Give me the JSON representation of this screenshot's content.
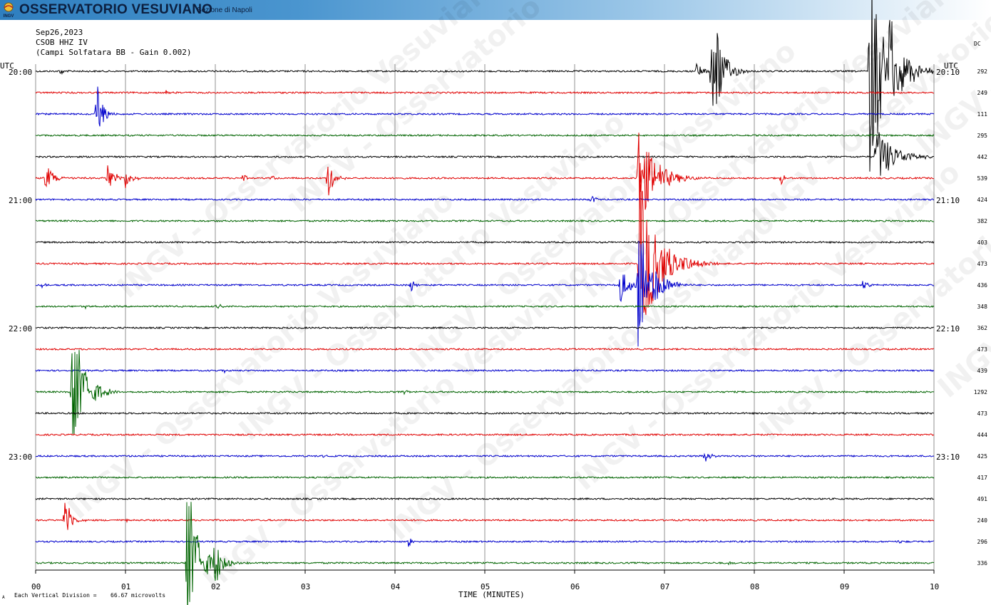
{
  "header": {
    "org_title": "OSSERVATORIO VESUVIANO",
    "org_subtitle": "Sezione di Napoli",
    "logo_text": "INGV",
    "date": "Sep26,2023",
    "station": "CSOB HHZ IV",
    "description": "(Campi Solfatara BB - Gain 0.002)"
  },
  "watermark": "INGV - Osservatorio Vesuviano",
  "footer": {
    "division_label": "Each Vertical Division =",
    "division_value": "66.67 microvolts",
    "corner_mark": "A"
  },
  "colors": {
    "cycle": [
      "#000000",
      "#e00000",
      "#0000cc",
      "#006400"
    ],
    "grid": "#909090",
    "banner": "#2f7fbf"
  },
  "chart_data": {
    "type": "line",
    "title": "",
    "xlabel": "TIME (MINUTES)",
    "ylabel": "",
    "x_ticks": [
      "00",
      "01",
      "02",
      "03",
      "04",
      "05",
      "06",
      "07",
      "08",
      "09",
      "10"
    ],
    "xlim": [
      0,
      10
    ],
    "left_axis_label": "UTC",
    "right_axis_label": "UTC",
    "dc_header": "DC",
    "left_time_labels": [
      {
        "row": 0,
        "label": "20:00"
      },
      {
        "row": 6,
        "label": "21:00"
      },
      {
        "row": 12,
        "label": "22:00"
      },
      {
        "row": 18,
        "label": "23:00"
      }
    ],
    "right_time_labels": [
      {
        "row": 0,
        "label": "20:10"
      },
      {
        "row": 6,
        "label": "21:10"
      },
      {
        "row": 12,
        "label": "22:10"
      },
      {
        "row": 18,
        "label": "23:10"
      }
    ],
    "dc_values": [
      "292",
      "249",
      "111",
      "295",
      "442",
      "539",
      "424",
      "382",
      "403",
      "473",
      "436",
      "348",
      "362",
      "473",
      "439",
      "1292",
      "473",
      "444",
      "425",
      "417",
      "491",
      "240",
      "296",
      "336"
    ],
    "events": [
      {
        "row": 0,
        "t": 0.27,
        "amp": 0.25,
        "dur": 0.15
      },
      {
        "row": 0,
        "t": 7.35,
        "amp": 0.6,
        "dur": 0.25
      },
      {
        "row": 0,
        "t": 7.52,
        "amp": 3.5,
        "dur": 0.45
      },
      {
        "row": 0,
        "t": 9.28,
        "amp": 5.0,
        "dur": 0.8
      },
      {
        "row": 0,
        "t": 9.48,
        "amp": 2.5,
        "dur": 0.6
      },
      {
        "row": 1,
        "t": 1.45,
        "amp": 0.12,
        "dur": 0.2
      },
      {
        "row": 2,
        "t": 0.67,
        "amp": 2.3,
        "dur": 0.25
      },
      {
        "row": 4,
        "t": 9.35,
        "amp": 1.5,
        "dur": 0.8
      },
      {
        "row": 5,
        "t": 0.1,
        "amp": 0.8,
        "dur": 0.35
      },
      {
        "row": 5,
        "t": 0.8,
        "amp": 0.8,
        "dur": 0.3
      },
      {
        "row": 5,
        "t": 1.0,
        "amp": 0.6,
        "dur": 0.25
      },
      {
        "row": 5,
        "t": 2.3,
        "amp": 0.3,
        "dur": 0.15
      },
      {
        "row": 5,
        "t": 2.62,
        "amp": 0.2,
        "dur": 0.12
      },
      {
        "row": 5,
        "t": 3.25,
        "amp": 1.0,
        "dur": 0.3
      },
      {
        "row": 5,
        "t": 8.3,
        "amp": 0.35,
        "dur": 0.15
      },
      {
        "row": 5,
        "t": 6.7,
        "amp": 2.5,
        "dur": 0.8
      },
      {
        "row": 6,
        "t": 6.18,
        "amp": 0.4,
        "dur": 0.15
      },
      {
        "row": 9,
        "t": 6.72,
        "amp": 4.0,
        "dur": 0.9
      },
      {
        "row": 10,
        "t": 0.07,
        "amp": 0.12,
        "dur": 0.15
      },
      {
        "row": 10,
        "t": 4.18,
        "amp": 0.45,
        "dur": 0.15
      },
      {
        "row": 10,
        "t": 6.5,
        "amp": 1.1,
        "dur": 0.35
      },
      {
        "row": 10,
        "t": 6.7,
        "amp": 3.5,
        "dur": 0.6
      },
      {
        "row": 10,
        "t": 9.2,
        "amp": 0.3,
        "dur": 0.2
      },
      {
        "row": 11,
        "t": 0.55,
        "amp": 0.1,
        "dur": 0.12
      },
      {
        "row": 11,
        "t": 1.5,
        "amp": 0.12,
        "dur": 0.15
      },
      {
        "row": 11,
        "t": 2.02,
        "amp": 0.3,
        "dur": 0.12
      },
      {
        "row": 13,
        "t": 8.75,
        "amp": 0.05,
        "dur": 0.1
      },
      {
        "row": 14,
        "t": 2.1,
        "amp": 0.12,
        "dur": 0.12
      },
      {
        "row": 15,
        "t": 0.4,
        "amp": 3.9,
        "dur": 0.55
      },
      {
        "row": 15,
        "t": 4.1,
        "amp": 0.1,
        "dur": 0.15
      },
      {
        "row": 18,
        "t": 3.2,
        "amp": 0.1,
        "dur": 0.1
      },
      {
        "row": 18,
        "t": 7.45,
        "amp": 0.35,
        "dur": 0.25
      },
      {
        "row": 21,
        "t": 0.32,
        "amp": 1.5,
        "dur": 0.25
      },
      {
        "row": 21,
        "t": 1.0,
        "amp": 0.1,
        "dur": 0.1
      },
      {
        "row": 22,
        "t": 4.15,
        "amp": 0.3,
        "dur": 0.12
      },
      {
        "row": 22,
        "t": 9.6,
        "amp": 0.1,
        "dur": 0.15
      },
      {
        "row": 23,
        "t": 1.68,
        "amp": 4.5,
        "dur": 0.5
      },
      {
        "row": 23,
        "t": 1.98,
        "amp": 1.2,
        "dur": 0.4
      },
      {
        "row": 23,
        "t": 7.7,
        "amp": 0.12,
        "dur": 0.2
      }
    ]
  }
}
